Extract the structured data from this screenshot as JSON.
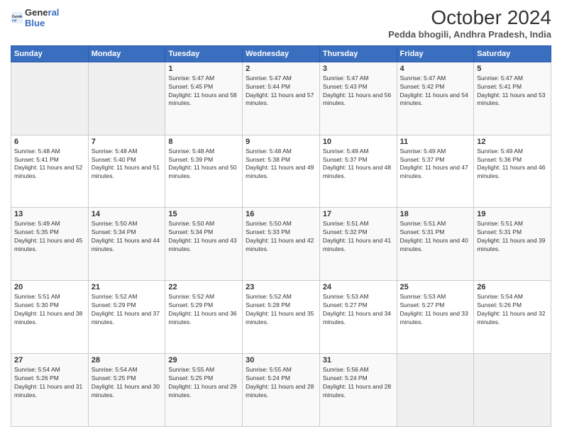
{
  "logo": {
    "line1": "General",
    "line2": "Blue"
  },
  "title": "October 2024",
  "subtitle": "Pedda bhogili, Andhra Pradesh, India",
  "days": [
    "Sunday",
    "Monday",
    "Tuesday",
    "Wednesday",
    "Thursday",
    "Friday",
    "Saturday"
  ],
  "weeks": [
    [
      {
        "day": "",
        "info": ""
      },
      {
        "day": "",
        "info": ""
      },
      {
        "day": "1",
        "info": "Sunrise: 5:47 AM\nSunset: 5:45 PM\nDaylight: 11 hours and 58 minutes."
      },
      {
        "day": "2",
        "info": "Sunrise: 5:47 AM\nSunset: 5:44 PM\nDaylight: 11 hours and 57 minutes."
      },
      {
        "day": "3",
        "info": "Sunrise: 5:47 AM\nSunset: 5:43 PM\nDaylight: 11 hours and 56 minutes."
      },
      {
        "day": "4",
        "info": "Sunrise: 5:47 AM\nSunset: 5:42 PM\nDaylight: 11 hours and 54 minutes."
      },
      {
        "day": "5",
        "info": "Sunrise: 5:47 AM\nSunset: 5:41 PM\nDaylight: 11 hours and 53 minutes."
      }
    ],
    [
      {
        "day": "6",
        "info": "Sunrise: 5:48 AM\nSunset: 5:41 PM\nDaylight: 11 hours and 52 minutes."
      },
      {
        "day": "7",
        "info": "Sunrise: 5:48 AM\nSunset: 5:40 PM\nDaylight: 11 hours and 51 minutes."
      },
      {
        "day": "8",
        "info": "Sunrise: 5:48 AM\nSunset: 5:39 PM\nDaylight: 11 hours and 50 minutes."
      },
      {
        "day": "9",
        "info": "Sunrise: 5:48 AM\nSunset: 5:38 PM\nDaylight: 11 hours and 49 minutes."
      },
      {
        "day": "10",
        "info": "Sunrise: 5:49 AM\nSunset: 5:37 PM\nDaylight: 11 hours and 48 minutes."
      },
      {
        "day": "11",
        "info": "Sunrise: 5:49 AM\nSunset: 5:37 PM\nDaylight: 11 hours and 47 minutes."
      },
      {
        "day": "12",
        "info": "Sunrise: 5:49 AM\nSunset: 5:36 PM\nDaylight: 11 hours and 46 minutes."
      }
    ],
    [
      {
        "day": "13",
        "info": "Sunrise: 5:49 AM\nSunset: 5:35 PM\nDaylight: 11 hours and 45 minutes."
      },
      {
        "day": "14",
        "info": "Sunrise: 5:50 AM\nSunset: 5:34 PM\nDaylight: 11 hours and 44 minutes."
      },
      {
        "day": "15",
        "info": "Sunrise: 5:50 AM\nSunset: 5:34 PM\nDaylight: 11 hours and 43 minutes."
      },
      {
        "day": "16",
        "info": "Sunrise: 5:50 AM\nSunset: 5:33 PM\nDaylight: 11 hours and 42 minutes."
      },
      {
        "day": "17",
        "info": "Sunrise: 5:51 AM\nSunset: 5:32 PM\nDaylight: 11 hours and 41 minutes."
      },
      {
        "day": "18",
        "info": "Sunrise: 5:51 AM\nSunset: 5:31 PM\nDaylight: 11 hours and 40 minutes."
      },
      {
        "day": "19",
        "info": "Sunrise: 5:51 AM\nSunset: 5:31 PM\nDaylight: 11 hours and 39 minutes."
      }
    ],
    [
      {
        "day": "20",
        "info": "Sunrise: 5:51 AM\nSunset: 5:30 PM\nDaylight: 11 hours and 38 minutes."
      },
      {
        "day": "21",
        "info": "Sunrise: 5:52 AM\nSunset: 5:29 PM\nDaylight: 11 hours and 37 minutes."
      },
      {
        "day": "22",
        "info": "Sunrise: 5:52 AM\nSunset: 5:29 PM\nDaylight: 11 hours and 36 minutes."
      },
      {
        "day": "23",
        "info": "Sunrise: 5:52 AM\nSunset: 5:28 PM\nDaylight: 11 hours and 35 minutes."
      },
      {
        "day": "24",
        "info": "Sunrise: 5:53 AM\nSunset: 5:27 PM\nDaylight: 11 hours and 34 minutes."
      },
      {
        "day": "25",
        "info": "Sunrise: 5:53 AM\nSunset: 5:27 PM\nDaylight: 11 hours and 33 minutes."
      },
      {
        "day": "26",
        "info": "Sunrise: 5:54 AM\nSunset: 5:26 PM\nDaylight: 11 hours and 32 minutes."
      }
    ],
    [
      {
        "day": "27",
        "info": "Sunrise: 5:54 AM\nSunset: 5:26 PM\nDaylight: 11 hours and 31 minutes."
      },
      {
        "day": "28",
        "info": "Sunrise: 5:54 AM\nSunset: 5:25 PM\nDaylight: 11 hours and 30 minutes."
      },
      {
        "day": "29",
        "info": "Sunrise: 5:55 AM\nSunset: 5:25 PM\nDaylight: 11 hours and 29 minutes."
      },
      {
        "day": "30",
        "info": "Sunrise: 5:55 AM\nSunset: 5:24 PM\nDaylight: 11 hours and 28 minutes."
      },
      {
        "day": "31",
        "info": "Sunrise: 5:56 AM\nSunset: 5:24 PM\nDaylight: 11 hours and 28 minutes."
      },
      {
        "day": "",
        "info": ""
      },
      {
        "day": "",
        "info": ""
      }
    ]
  ]
}
